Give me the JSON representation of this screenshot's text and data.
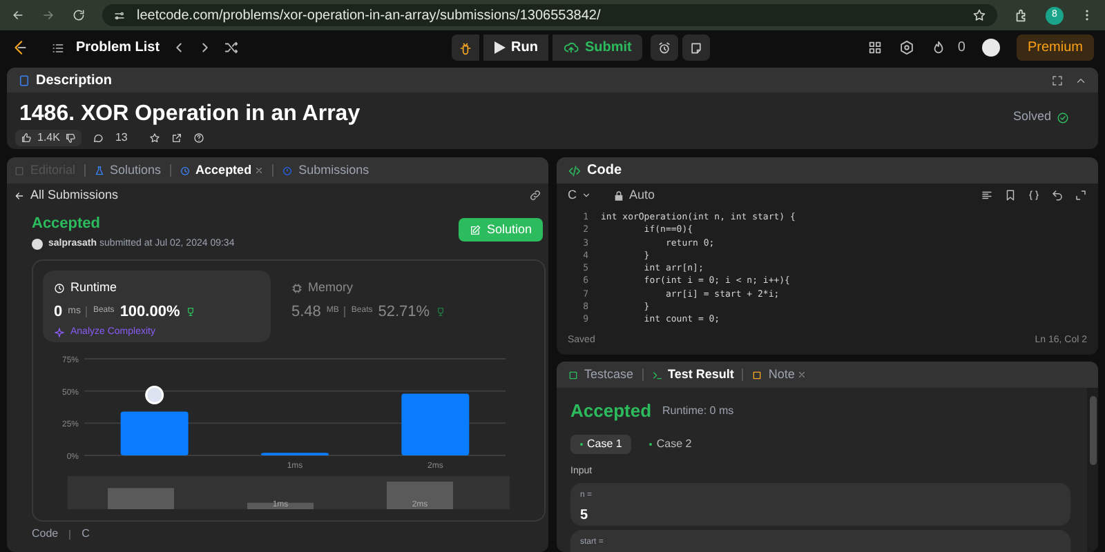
{
  "browser": {
    "url": "leetcode.com/problems/xor-operation-in-an-array/submissions/1306553842/",
    "profile": "8"
  },
  "toolbar": {
    "problem_list": "Problem List",
    "run": "Run",
    "submit": "Submit",
    "streak": "0",
    "premium": "Premium"
  },
  "description": {
    "tab": "Description",
    "title": "1486. XOR Operation in an Array",
    "status": "Solved",
    "likes": "1.4K",
    "comments": "13"
  },
  "left_tabs": [
    {
      "label": "Editorial",
      "selected": false
    },
    {
      "label": "Solutions",
      "selected": false
    },
    {
      "label": "Accepted",
      "selected": true
    },
    {
      "label": "Submissions",
      "selected": false
    }
  ],
  "submission": {
    "back": "All Submissions",
    "status": "Accepted",
    "user": "salprasath",
    "submitted": "submitted at Jul 02, 2024 09:34",
    "solution_button": "Solution",
    "runtime": {
      "label": "Runtime",
      "value": "0",
      "unit": "ms",
      "beats_label": "Beats",
      "beats": "100.00%"
    },
    "analyze": "Analyze Complexity",
    "memory": {
      "label": "Memory",
      "value": "5.48",
      "unit": "MB",
      "beats_label": "Beats",
      "beats": "52.71%"
    },
    "chart_data": {
      "type": "bar",
      "categories": [
        null,
        "1ms",
        "2ms"
      ],
      "yticks": [
        {
          "value": 0,
          "label": "0%"
        },
        {
          "value": 25,
          "label": "25%"
        },
        {
          "value": 50,
          "label": "50%"
        },
        {
          "value": 75,
          "label": "75%"
        }
      ],
      "ylim": [
        0,
        75
      ],
      "series": [
        {
          "color": "#0a7cff",
          "values": [
            34,
            2,
            48
          ]
        }
      ]
    },
    "overview_labels": [
      "1ms",
      "2ms"
    ],
    "code_label": "Code",
    "code_lang": "C"
  },
  "code": {
    "tab": "Code",
    "language": "C",
    "mode": "Auto",
    "status": "Saved",
    "position": "Ln 16, Col 2",
    "lines": [
      {
        "num": "1",
        "text": "int xorOperation(int n, int start) {"
      },
      {
        "num": "2",
        "text": "        if(n==0){"
      },
      {
        "num": "3",
        "text": "            return 0;"
      },
      {
        "num": "4",
        "text": "        }"
      },
      {
        "num": "5",
        "text": "        int arr[n];"
      },
      {
        "num": "6",
        "text": "        for(int i = 0; i < n; i++){"
      },
      {
        "num": "7",
        "text": "            arr[i] = start + 2*i;"
      },
      {
        "num": "8",
        "text": "        }"
      },
      {
        "num": "9",
        "text": "        int count = 0;"
      }
    ]
  },
  "result_tabs": [
    {
      "label": "Testcase",
      "selected": false
    },
    {
      "label": "Test Result",
      "selected": true
    },
    {
      "label": "Note",
      "selected": false
    }
  ],
  "result": {
    "status": "Accepted",
    "runtime": "Runtime: 0 ms",
    "cases": [
      {
        "label": "Case 1",
        "selected": true
      },
      {
        "label": "Case 2",
        "selected": false
      }
    ],
    "input_label": "Input",
    "inputs": [
      {
        "name": "n =",
        "value": "5"
      },
      {
        "name": "start ="
      }
    ]
  }
}
